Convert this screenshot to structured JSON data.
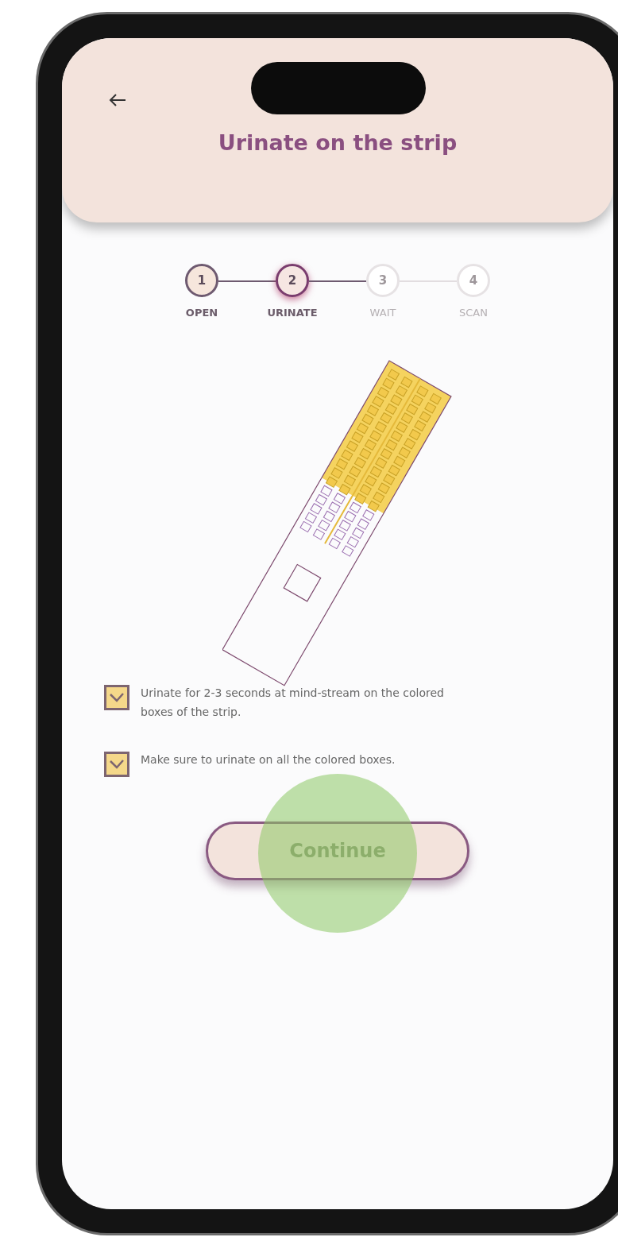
{
  "header": {
    "title": "Urinate on the strip"
  },
  "steps": [
    {
      "number": "1",
      "label": "OPEN",
      "completed": true,
      "selected": false
    },
    {
      "number": "2",
      "label": "URINATE",
      "completed": false,
      "selected": true
    },
    {
      "number": "3",
      "label": "WAIT",
      "completed": false,
      "selected": false
    },
    {
      "number": "4",
      "label": "SCAN",
      "completed": false,
      "selected": false
    }
  ],
  "instructions": [
    {
      "text": "Urinate for 2-3 seconds at mind-stream on the colored boxes of the strip.",
      "checked": true
    },
    {
      "text": "Make sure to urinate on all the colored boxes.",
      "checked": true
    }
  ],
  "continue_button": {
    "label": "Continue",
    "touched": true
  }
}
